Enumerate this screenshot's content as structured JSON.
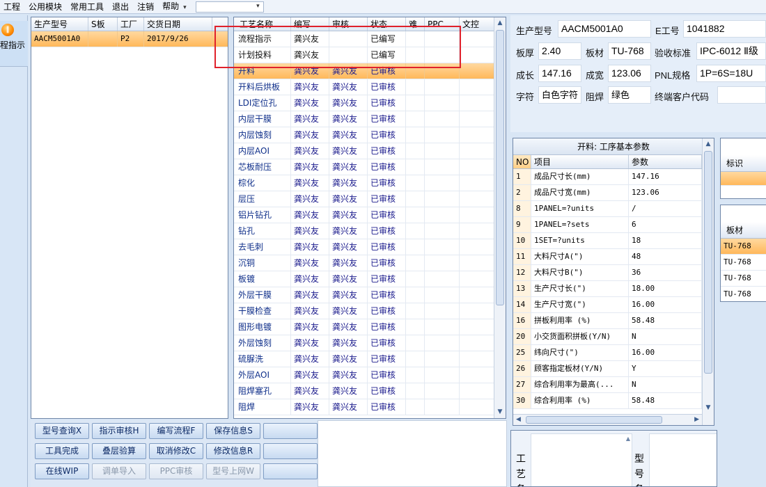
{
  "menu": {
    "items": [
      "工程",
      "公用模块",
      "常用工具",
      "退出",
      "注销",
      "帮助"
    ],
    "dropdown_arrow": "▾"
  },
  "toolbar": {
    "icon": "orange-disc-icon",
    "label": "程指示"
  },
  "order_grid": {
    "columns": [
      "生产型号",
      "S板",
      "工厂",
      "交货日期"
    ],
    "rows": [
      {
        "model": "AACM5001A0",
        "s_board": "",
        "factory": "P2",
        "delivery": "2017/9/26"
      }
    ]
  },
  "process_grid": {
    "columns": [
      "工艺名称",
      "编写",
      "审核",
      "状态",
      "难",
      "PPC",
      "文控"
    ],
    "rows": [
      {
        "name": "流程指示",
        "writer": "龚兴友",
        "reviewer": "",
        "status": "已编写"
      },
      {
        "name": "计划投料",
        "writer": "龚兴友",
        "reviewer": "",
        "status": "已编写"
      },
      {
        "name": "开料",
        "writer": "龚兴友",
        "reviewer": "龚兴友",
        "status": "已审核"
      },
      {
        "name": "开料后烘板",
        "writer": "龚兴友",
        "reviewer": "龚兴友",
        "status": "已审核"
      },
      {
        "name": "LDI定位孔",
        "writer": "龚兴友",
        "reviewer": "龚兴友",
        "status": "已审核"
      },
      {
        "name": "内层干膜",
        "writer": "龚兴友",
        "reviewer": "龚兴友",
        "status": "已审核"
      },
      {
        "name": "内层蚀刻",
        "writer": "龚兴友",
        "reviewer": "龚兴友",
        "status": "已审核"
      },
      {
        "name": "内层AOI",
        "writer": "龚兴友",
        "reviewer": "龚兴友",
        "status": "已审核"
      },
      {
        "name": "芯板耐压",
        "writer": "龚兴友",
        "reviewer": "龚兴友",
        "status": "已审核"
      },
      {
        "name": "棕化",
        "writer": "龚兴友",
        "reviewer": "龚兴友",
        "status": "已审核"
      },
      {
        "name": "层压",
        "writer": "龚兴友",
        "reviewer": "龚兴友",
        "status": "已审核"
      },
      {
        "name": "铝片钻孔",
        "writer": "龚兴友",
        "reviewer": "龚兴友",
        "status": "已审核"
      },
      {
        "name": "钻孔",
        "writer": "龚兴友",
        "reviewer": "龚兴友",
        "status": "已审核"
      },
      {
        "name": "去毛刺",
        "writer": "龚兴友",
        "reviewer": "龚兴友",
        "status": "已审核"
      },
      {
        "name": "沉铜",
        "writer": "龚兴友",
        "reviewer": "龚兴友",
        "status": "已审核"
      },
      {
        "name": "板镀",
        "writer": "龚兴友",
        "reviewer": "龚兴友",
        "status": "已审核"
      },
      {
        "name": "外层干膜",
        "writer": "龚兴友",
        "reviewer": "龚兴友",
        "status": "已审核"
      },
      {
        "name": "干膜检查",
        "writer": "龚兴友",
        "reviewer": "龚兴友",
        "status": "已审核"
      },
      {
        "name": "图形电镀",
        "writer": "龚兴友",
        "reviewer": "龚兴友",
        "status": "已审核"
      },
      {
        "name": "外层蚀刻",
        "writer": "龚兴友",
        "reviewer": "龚兴友",
        "status": "已审核"
      },
      {
        "name": "硫脲洗",
        "writer": "龚兴友",
        "reviewer": "龚兴友",
        "status": "已审核"
      },
      {
        "name": "外层AOI",
        "writer": "龚兴友",
        "reviewer": "龚兴友",
        "status": "已审核"
      },
      {
        "name": "阻焊塞孔",
        "writer": "龚兴友",
        "reviewer": "龚兴友",
        "status": "已审核"
      },
      {
        "name": "阻焊",
        "writer": "龚兴友",
        "reviewer": "龚兴友",
        "status": "已审核"
      }
    ]
  },
  "buttons": {
    "row1": [
      "型号查询X",
      "指示审核H",
      "编写流程F",
      "保存信息S",
      ""
    ],
    "row2": [
      "工具完成",
      "叠层验算",
      "取消修改C",
      "修改信息R",
      ""
    ],
    "row3": [
      "在线WIP",
      "调单导入",
      "PPC审核",
      "型号上网W",
      ""
    ]
  },
  "info": {
    "model_label": "生产型号",
    "model_value": "AACM5001A0",
    "e_label": "E工号",
    "e_value": "1041882",
    "thickness_label": "板厚",
    "thickness_value": "2.40",
    "material_label": "板材",
    "material_value": "TU-768",
    "standard_label": "验收标准",
    "standard_value": "IPC-6012 Ⅱ级",
    "length_label": "成长",
    "length_value": "147.16",
    "width_label": "成宽",
    "width_value": "123.06",
    "pnl_label": "PNL规格",
    "pnl_value": "1P=6S=18U",
    "char_label": "字符",
    "char_value": "白色字符",
    "mask_label": "阻焊",
    "mask_value": "绿色",
    "customer_label": "终端客户代码",
    "customer_value": ""
  },
  "params": {
    "title": "开料: 工序基本参数",
    "columns": [
      "NO",
      "项目",
      "参数"
    ],
    "rows": [
      {
        "no": "1",
        "item": "成品尺寸长(mm)",
        "value": "147.16"
      },
      {
        "no": "2",
        "item": "成品尺寸宽(mm)",
        "value": "123.06"
      },
      {
        "no": "8",
        "item": "1PANEL=?units",
        "value": "/"
      },
      {
        "no": "9",
        "item": "1PANEL=?sets",
        "value": "6"
      },
      {
        "no": "10",
        "item": "1SET=?units",
        "value": "18"
      },
      {
        "no": "11",
        "item": "大料尺寸A(\")",
        "value": "48"
      },
      {
        "no": "12",
        "item": "大料尺寸B(\")",
        "value": "36"
      },
      {
        "no": "13",
        "item": "生产尺寸长(\")",
        "value": "18.00"
      },
      {
        "no": "14",
        "item": "生产尺寸宽(\")",
        "value": "16.00"
      },
      {
        "no": "16",
        "item": "拼板利用率 (%)",
        "value": "58.48"
      },
      {
        "no": "20",
        "item": "小交货面积拼板(Y/N)",
        "value": "N"
      },
      {
        "no": "25",
        "item": "纬向尺寸(\")",
        "value": "16.00"
      },
      {
        "no": "26",
        "item": "顾客指定板材(Y/N)",
        "value": "Y"
      },
      {
        "no": "27",
        "item": "综合利用率为最高(...",
        "value": "N"
      },
      {
        "no": "30",
        "item": "综合利用率 (%)",
        "value": "58.48"
      }
    ]
  },
  "mark_panel": {
    "header": "标识"
  },
  "material_panel": {
    "header": "板材",
    "rows": [
      "TU-768",
      "TU-768",
      "TU-768",
      "TU-768"
    ]
  },
  "bottom_panel": {
    "label_left": "工艺备",
    "label_right": "型号备"
  }
}
